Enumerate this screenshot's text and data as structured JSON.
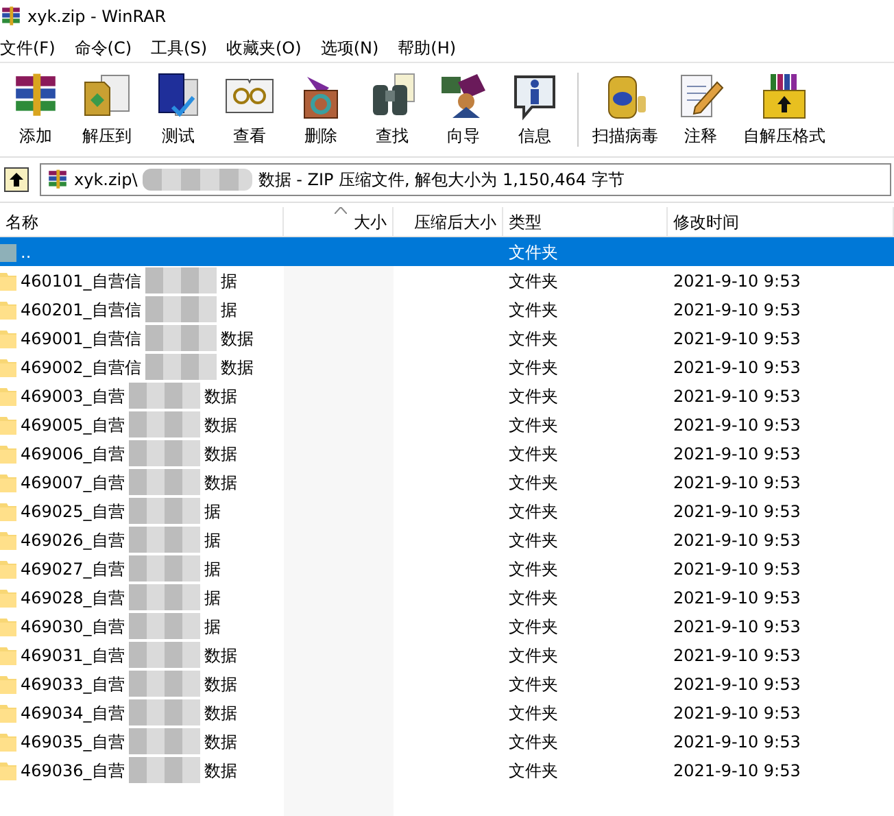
{
  "window": {
    "title": "xyk.zip - WinRAR"
  },
  "menu": [
    "文件(F)",
    "命令(C)",
    "工具(S)",
    "收藏夹(O)",
    "选项(N)",
    "帮助(H)"
  ],
  "toolbar": [
    {
      "label": "添加"
    },
    {
      "label": "解压到"
    },
    {
      "label": "测试"
    },
    {
      "label": "查看"
    },
    {
      "label": "删除"
    },
    {
      "label": "查找"
    },
    {
      "label": "向导"
    },
    {
      "label": "信息"
    },
    {
      "label": "扫描病毒"
    },
    {
      "label": "注释"
    },
    {
      "label": "自解压格式"
    }
  ],
  "address": {
    "path_start": "xyk.zip\\",
    "path_end": "数据 - ZIP 压缩文件, 解包大小为 1,150,464 字节"
  },
  "table": {
    "columns": [
      {
        "label": "名称",
        "sorted": false
      },
      {
        "label": "大小",
        "sorted": true
      },
      {
        "label": "压缩后大小",
        "sorted": false
      },
      {
        "label": "类型",
        "sorted": false
      },
      {
        "label": "修改时间",
        "sorted": false
      }
    ],
    "rows": [
      {
        "kind": "parent",
        "name_start": "..",
        "name_end": "",
        "type": "文件夹",
        "modified": "",
        "selected": true
      },
      {
        "kind": "folder",
        "name_start": "460101_自营信",
        "name_end": "据",
        "type": "文件夹",
        "modified": "2021-9-10 9:53",
        "selected": false
      },
      {
        "kind": "folder",
        "name_start": "460201_自营信",
        "name_end": "据",
        "type": "文件夹",
        "modified": "2021-9-10 9:53",
        "selected": false
      },
      {
        "kind": "folder",
        "name_start": "469001_自营信",
        "name_end": "数据",
        "type": "文件夹",
        "modified": "2021-9-10 9:53",
        "selected": false
      },
      {
        "kind": "folder",
        "name_start": "469002_自营信",
        "name_end": "数据",
        "type": "文件夹",
        "modified": "2021-9-10 9:53",
        "selected": false
      },
      {
        "kind": "folder",
        "name_start": "469003_自营",
        "name_end": "数据",
        "type": "文件夹",
        "modified": "2021-9-10 9:53",
        "selected": false
      },
      {
        "kind": "folder",
        "name_start": "469005_自营",
        "name_end": "数据",
        "type": "文件夹",
        "modified": "2021-9-10 9:53",
        "selected": false
      },
      {
        "kind": "folder",
        "name_start": "469006_自营",
        "name_end": "数据",
        "type": "文件夹",
        "modified": "2021-9-10 9:53",
        "selected": false
      },
      {
        "kind": "folder",
        "name_start": "469007_自营",
        "name_end": "数据",
        "type": "文件夹",
        "modified": "2021-9-10 9:53",
        "selected": false
      },
      {
        "kind": "folder",
        "name_start": "469025_自营",
        "name_end": "据",
        "type": "文件夹",
        "modified": "2021-9-10 9:53",
        "selected": false
      },
      {
        "kind": "folder",
        "name_start": "469026_自营",
        "name_end": "据",
        "type": "文件夹",
        "modified": "2021-9-10 9:53",
        "selected": false
      },
      {
        "kind": "folder",
        "name_start": "469027_自营",
        "name_end": "据",
        "type": "文件夹",
        "modified": "2021-9-10 9:53",
        "selected": false
      },
      {
        "kind": "folder",
        "name_start": "469028_自营",
        "name_end": "据",
        "type": "文件夹",
        "modified": "2021-9-10 9:53",
        "selected": false
      },
      {
        "kind": "folder",
        "name_start": "469030_自营",
        "name_end": "据",
        "type": "文件夹",
        "modified": "2021-9-10 9:53",
        "selected": false
      },
      {
        "kind": "folder",
        "name_start": "469031_自营",
        "name_end": "数据",
        "type": "文件夹",
        "modified": "2021-9-10 9:53",
        "selected": false
      },
      {
        "kind": "folder",
        "name_start": "469033_自营",
        "name_end": "数据",
        "type": "文件夹",
        "modified": "2021-9-10 9:53",
        "selected": false
      },
      {
        "kind": "folder",
        "name_start": "469034_自营",
        "name_end": "数据",
        "type": "文件夹",
        "modified": "2021-9-10 9:53",
        "selected": false
      },
      {
        "kind": "folder",
        "name_start": "469035_自营",
        "name_end": "数据",
        "type": "文件夹",
        "modified": "2021-9-10 9:53",
        "selected": false
      },
      {
        "kind": "folder",
        "name_start": "469036_自营",
        "name_end": "数据",
        "type": "文件夹",
        "modified": "2021-9-10 9:53",
        "selected": false
      }
    ]
  }
}
